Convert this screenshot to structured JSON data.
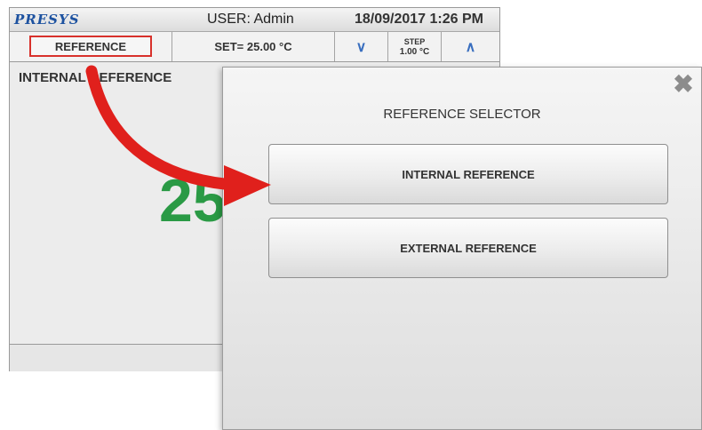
{
  "topbar": {
    "logo": "PRESYS",
    "user": "USER: Admin",
    "datetime": "18/09/2017  1:26 PM"
  },
  "toolbar": {
    "reference_label": "REFERENCE",
    "set_label": "SET= 25.00 °C",
    "step_label": "STEP",
    "step_value": "1.00 °C",
    "down_icon": "chevron-down-icon",
    "up_icon": "chevron-up-icon"
  },
  "main": {
    "mode_title": "INTERNAL REFERENCE",
    "value_display": "25"
  },
  "dialog": {
    "title": "REFERENCE SELECTOR",
    "options": [
      {
        "label": "INTERNAL REFERENCE"
      },
      {
        "label": "EXTERNAL REFERENCE"
      }
    ],
    "close_icon": "close-icon"
  },
  "colors": {
    "highlight": "#d8312b",
    "value_green": "#2a9a45",
    "logo_blue": "#1d52a0",
    "chevron_blue": "#3a6fbf"
  }
}
